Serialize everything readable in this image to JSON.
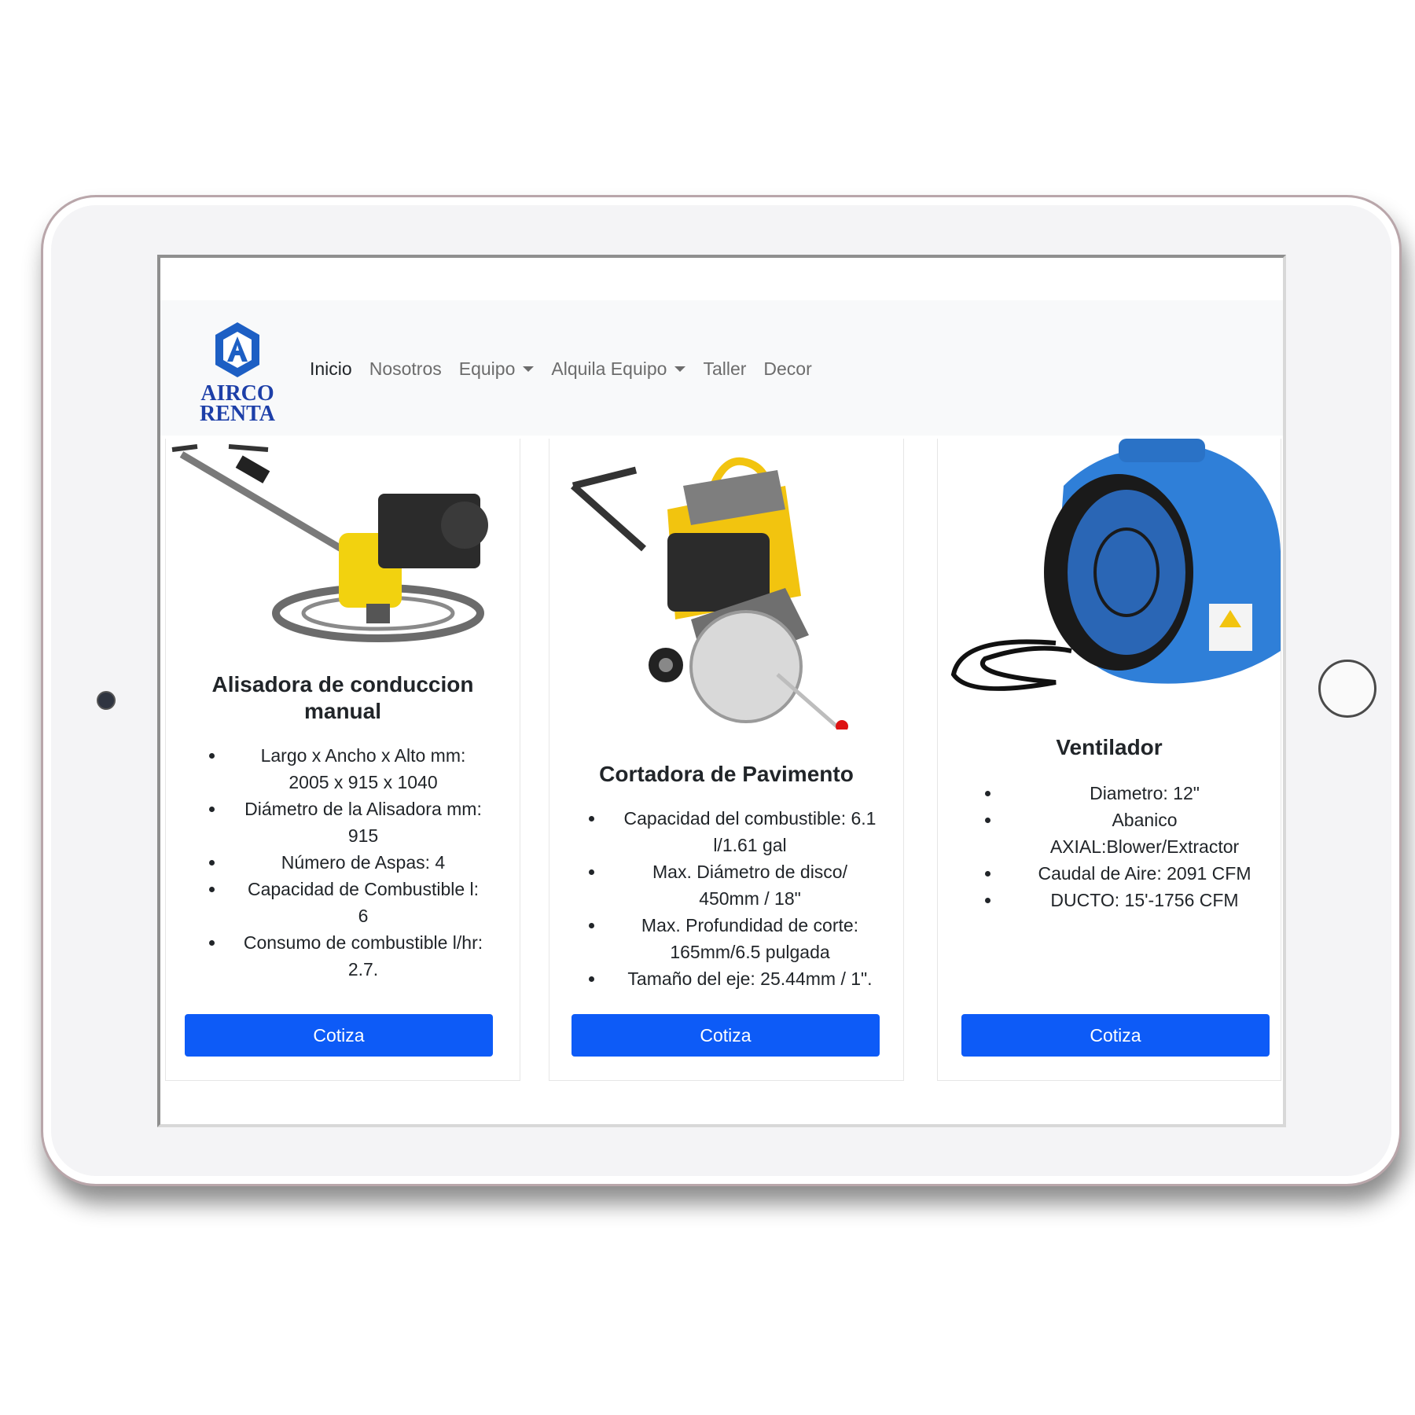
{
  "brand": {
    "line1": "AIRCO",
    "line2": "RENTA",
    "color": "#1d3fa8"
  },
  "nav": {
    "items": [
      {
        "label": "Inicio"
      },
      {
        "label": "Nosotros"
      },
      {
        "label": "Equipo"
      },
      {
        "label": "Alquila Equipo"
      },
      {
        "label": "Taller"
      },
      {
        "label": "Decor"
      }
    ]
  },
  "cards": [
    {
      "title": "Alisadora de conduccion manual",
      "specs": [
        "Largo x Ancho x Alto mm: 2005 x 915 x 1040",
        "Diámetro de la Alisadora mm: 915",
        "Número de Aspas: 4",
        "Capacidad de Combustible l: 6",
        "Consumo de combustible l/hr: 2.7."
      ],
      "button": "Cotiza"
    },
    {
      "title": "Cortadora de Pavimento",
      "specs": [
        "Capacidad del combustible: 6.1 l/1.61 gal",
        "Max. Diámetro de disco/ 450mm / 18\"",
        "Max. Profundidad de corte: 165mm/6.5 pulgada",
        "Tamaño del eje: 25.44mm / 1\"."
      ],
      "button": "Cotiza"
    },
    {
      "title": "Ventilador",
      "specs": [
        "Diametro: 12\"",
        "Abanico AXIAL:Blower/Extractor",
        "Caudal de Aire: 2091 CFM",
        "DUCTO: 15'-1756 CFM"
      ],
      "button": "Cotiza"
    }
  ],
  "colors": {
    "primary_button": "#0d5bf7",
    "navbar_bg": "#f8f9fa"
  }
}
